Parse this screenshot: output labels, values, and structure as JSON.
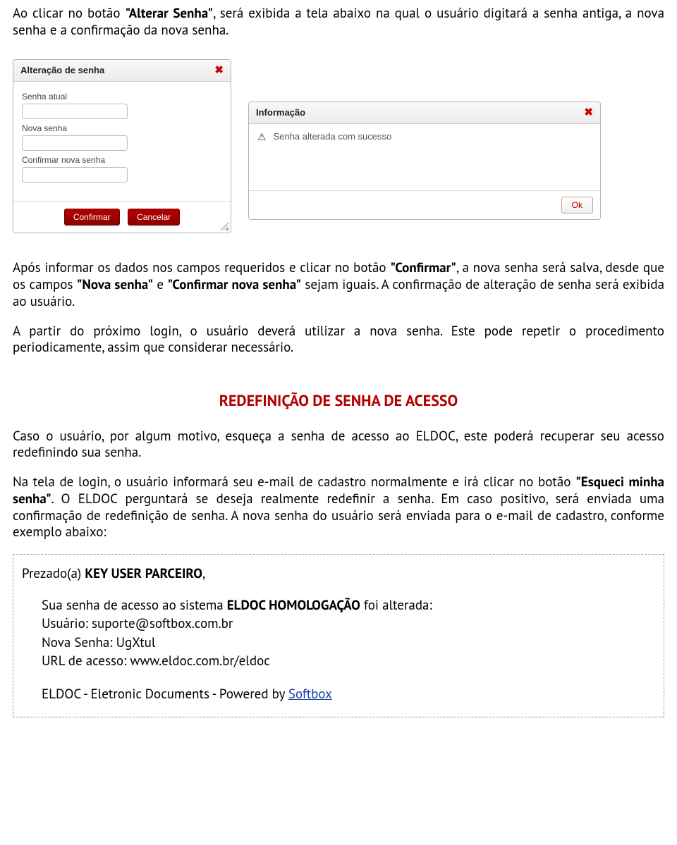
{
  "intro": {
    "p1_a": "Ao clicar no botão ",
    "p1_b": "\"Alterar Senha\"",
    "p1_c": ", será exibida a tela abaixo na qual o usuário digitará a senha antiga, a nova senha e a confirmação da nova senha."
  },
  "dialog_change": {
    "title": "Alteração de senha",
    "field1": "Senha atual",
    "field2": "Nova senha",
    "field3": "Confirmar nova senha",
    "confirm": "Confirmar",
    "cancel": "Cancelar"
  },
  "dialog_info": {
    "title": "Informação",
    "message": "Senha alterada com sucesso",
    "ok": "Ok"
  },
  "after": {
    "p1_a": "Após informar os dados nos campos requeridos e clicar no botão ",
    "p1_b": "\"Confirmar\"",
    "p1_c": ", a nova senha será salva, desde que os campos ",
    "p1_d": "\"Nova senha\"",
    "p1_e": " e ",
    "p1_f": "\"Confirmar nova senha\"",
    "p1_g": " sejam iguais. A confirmação de alteração de senha será exibida ao usuário.",
    "p2": "A partir do próximo login, o usuário deverá utilizar a nova senha. Este pode repetir o procedimento periodicamente, assim que considerar necessário."
  },
  "section_title": "REDEFINIÇÃO DE SENHA DE ACESSO",
  "reset": {
    "p1": "Caso o usuário, por algum motivo, esqueça a senha de acesso ao ELDOC, este poderá recuperar seu acesso redefinindo sua senha.",
    "p2_a": "Na tela de login, o usuário informará seu e-mail de cadastro normalmente e irá clicar no botão ",
    "p2_b": "\"Esqueci minha senha\"",
    "p2_c": ". O ELDOC perguntará se deseja realmente redefinir a senha. Em caso positivo, será enviada uma confirmação de redefinição de senha. A nova senha do usuário será enviada para o e-mail de cadastro, conforme exemplo abaixo:"
  },
  "email": {
    "greeting_a": "Prezado(a) ",
    "greeting_b": "KEY USER PARCEIRO",
    "greeting_c": ",",
    "line1_a": "Sua senha de acesso ao sistema ",
    "line1_b": "ELDOC HOMOLOGAÇÃO",
    "line1_c": " foi alterada:",
    "user_label": "Usuário: ",
    "user_value": "suporte@softbox.com.br",
    "pass_label": "Nova Senha: ",
    "pass_value": "UgXtul",
    "url_label": "URL de acesso: ",
    "url_value": "www.eldoc.com.br/eldoc",
    "footer_a": "ELDOC - Eletronic Documents - Powered by ",
    "footer_link": "Softbox"
  }
}
